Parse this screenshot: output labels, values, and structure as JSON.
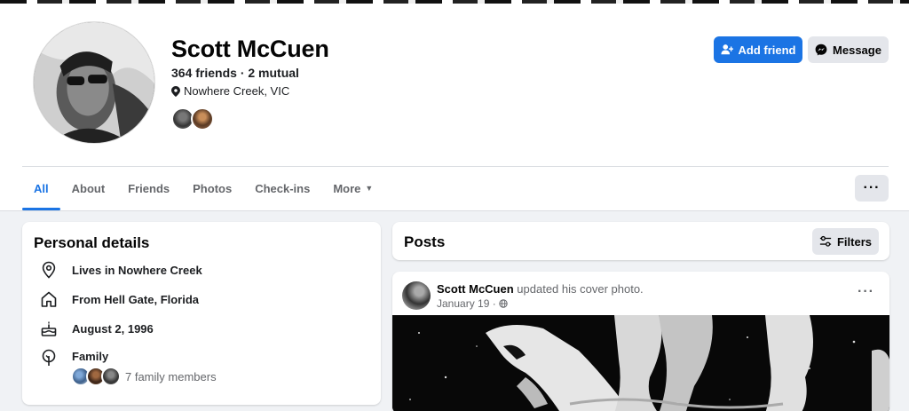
{
  "profile": {
    "name": "Scott McCuen",
    "friends_summary": "364 friends · 2 mutual",
    "location": "Nowhere Creek, VIC"
  },
  "actions": {
    "add_friend": "Add friend",
    "message": "Message",
    "more_options": "···"
  },
  "tabs": [
    {
      "label": "All",
      "active": true
    },
    {
      "label": "About"
    },
    {
      "label": "Friends"
    },
    {
      "label": "Photos"
    },
    {
      "label": "Check-ins"
    },
    {
      "label": "More"
    }
  ],
  "personal_details": {
    "title": "Personal details",
    "lives_in": "Lives in Nowhere Creek",
    "from": "From Hell Gate, Florida",
    "birthday": "August 2, 1996",
    "family_label": "Family",
    "family_members": "7 family members"
  },
  "posts": {
    "title": "Posts",
    "filters_label": "Filters",
    "post": {
      "author": "Scott McCuen",
      "action": " updated his cover photo.",
      "date": "January 19 ·",
      "options": "···"
    }
  },
  "colors": {
    "accent": "#1b74e4",
    "button_gray": "#e4e6eb",
    "page_bg": "#f0f2f5"
  },
  "icons": {
    "location": "map-pin-icon",
    "home": "home-icon",
    "birthday": "cake-icon",
    "family": "family-icon",
    "privacy": "globe-icon",
    "add_friend": "user-plus-icon",
    "message": "messenger-icon",
    "filters": "sliders-icon"
  }
}
